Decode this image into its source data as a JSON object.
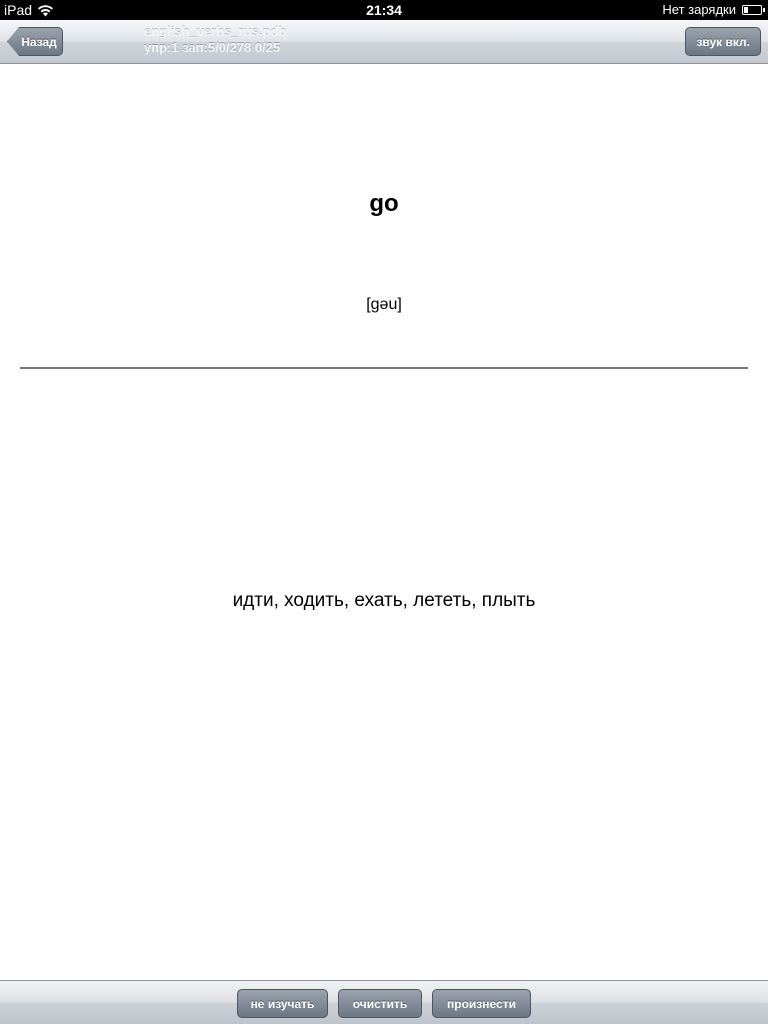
{
  "status_bar": {
    "device": "iPad",
    "time": "21:34",
    "charging": "Нет зарядки"
  },
  "nav": {
    "back_label": "Назад",
    "title_line1": "english_verbs_rus.pdb",
    "title_line2": "упр:1 зап:5/0/278 0/25",
    "sound_label": "звук вкл."
  },
  "card": {
    "word": "go",
    "transcription": "[gəu]",
    "translation": "идти, ходить, ехать, лететь, плыть"
  },
  "toolbar": {
    "skip_label": "не изучать",
    "clear_label": "очистить",
    "speak_label": "произнести"
  }
}
